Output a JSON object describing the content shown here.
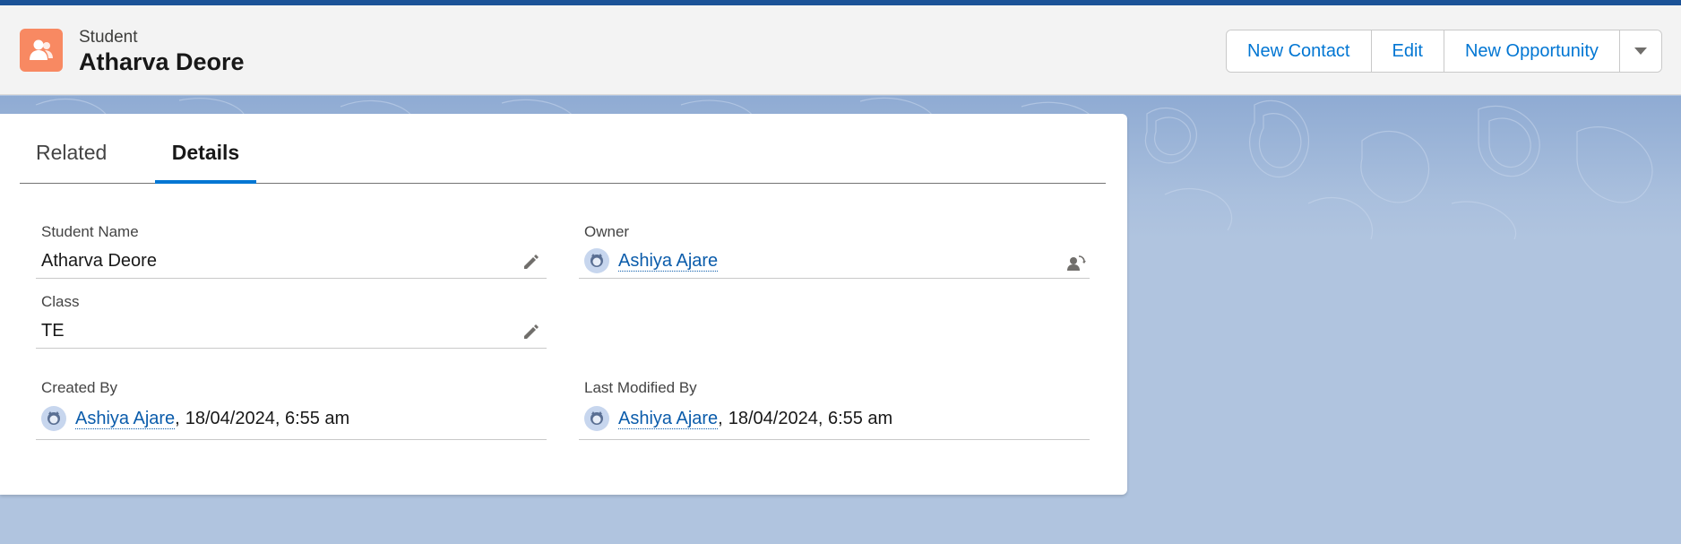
{
  "header": {
    "object_label": "Student",
    "record_title": "Atharva Deore",
    "actions": [
      "New Contact",
      "Edit",
      "New Opportunity"
    ],
    "menu_icon": "chevron-down-icon",
    "icon": "student-record-icon",
    "icon_color": "#f88962"
  },
  "tabs": [
    "Related",
    "Details"
  ],
  "active_tab": "Details",
  "fields": {
    "student_name": {
      "label": "Student Name",
      "value": "Atharva Deore"
    },
    "owner": {
      "label": "Owner",
      "value": "Ashiya Ajare"
    },
    "class": {
      "label": "Class",
      "value": "TE"
    },
    "created_by": {
      "label": "Created By",
      "user": "Ashiya Ajare",
      "separator": ",",
      "timestamp": "18/04/2024, 6:55 am"
    },
    "last_modified_by": {
      "label": "Last Modified By",
      "user": "Ashiya Ajare",
      "separator": ",",
      "timestamp": "18/04/2024, 6:55 am"
    }
  },
  "colors": {
    "brand": "#0176d3",
    "link": "#0b5cab",
    "top_strip": "#1b5297",
    "background": "#b0c4df"
  }
}
